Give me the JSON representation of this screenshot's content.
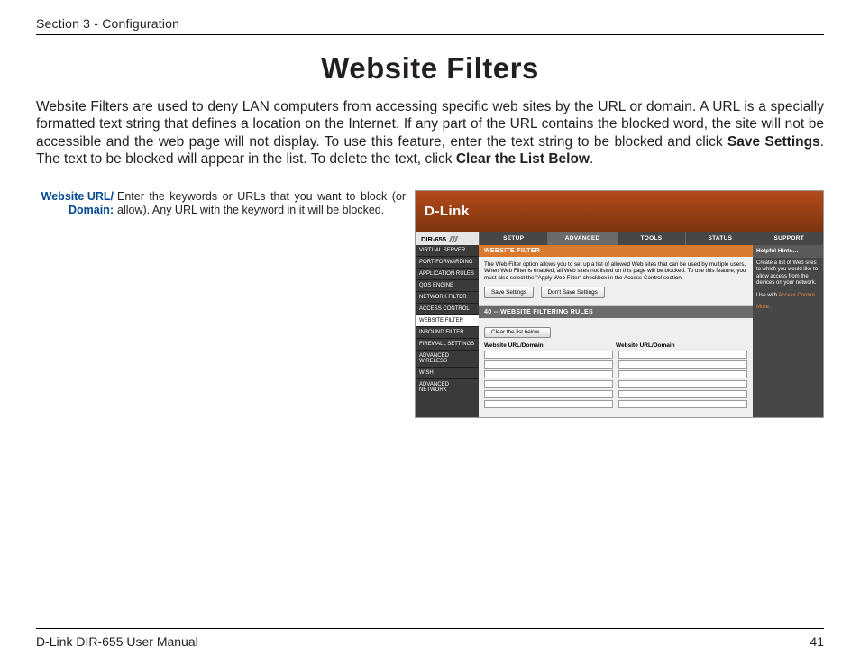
{
  "header": {
    "section": "Section 3 - Configuration"
  },
  "title": "Website Filters",
  "intro_parts": {
    "p1": "Website Filters are used to deny LAN computers from accessing specific web sites by the URL or domain. A URL is a specially formatted text string that defines a location on the Internet. If any part of the URL contains the blocked word, the site will not be accessible and the web page will not display. To use this feature, enter the text string to be blocked and click ",
    "b1": "Save Settings",
    "p2": ". The text to be blocked will appear in the list. To delete the text, click ",
    "b2": "Clear the List Below",
    "p3": "."
  },
  "definition": {
    "label_l1": "Website URL/",
    "label_l2": "Domain:",
    "text": "Enter the keywords or URLs that you want to block (or allow). Any URL with the keyword in it will be blocked."
  },
  "shot": {
    "logo": "D-Link",
    "model": "DIR-655",
    "tabs": [
      "SETUP",
      "ADVANCED",
      "TOOLS",
      "STATUS",
      "SUPPORT"
    ],
    "active_tab": 1,
    "sidebar": [
      "VIRTUAL SERVER",
      "PORT FORWARDING",
      "APPLICATION RULES",
      "QOS ENGINE",
      "NETWORK FILTER",
      "ACCESS CONTROL",
      "WEBSITE FILTER",
      "INBOUND FILTER",
      "FIREWALL SETTINGS",
      "ADVANCED WIRELESS",
      "WISH",
      "ADVANCED NETWORK"
    ],
    "sidebar_selected": 6,
    "panel1": {
      "title": "WEBSITE FILTER",
      "desc": "The Web Filter option allows you to set up a list of allowed Web sites that can be used by multiple users. When Web Filter is enabled, all Web sites not listed on this page will be blocked. To use this feature, you must also select the \"Apply Web Filter\" checkbox in the Access Control section.",
      "btn_save": "Save Settings",
      "btn_dont": "Don't Save Settings"
    },
    "panel2": {
      "title": "40 -- WEBSITE FILTERING RULES",
      "btn_clear": "Clear the list below...",
      "col1": "Website URL/Domain",
      "col2": "Website URL/Domain",
      "row_count": 6
    },
    "hints": {
      "title": "Helpful Hints…",
      "body1": "Create a list of Web sites to which you would like to allow access from the devices on your network.",
      "body2_pre": "Use with ",
      "body2_link": "Access Control",
      "more": "More…"
    }
  },
  "footer": {
    "left": "D-Link DIR-655 User Manual",
    "right": "41"
  }
}
